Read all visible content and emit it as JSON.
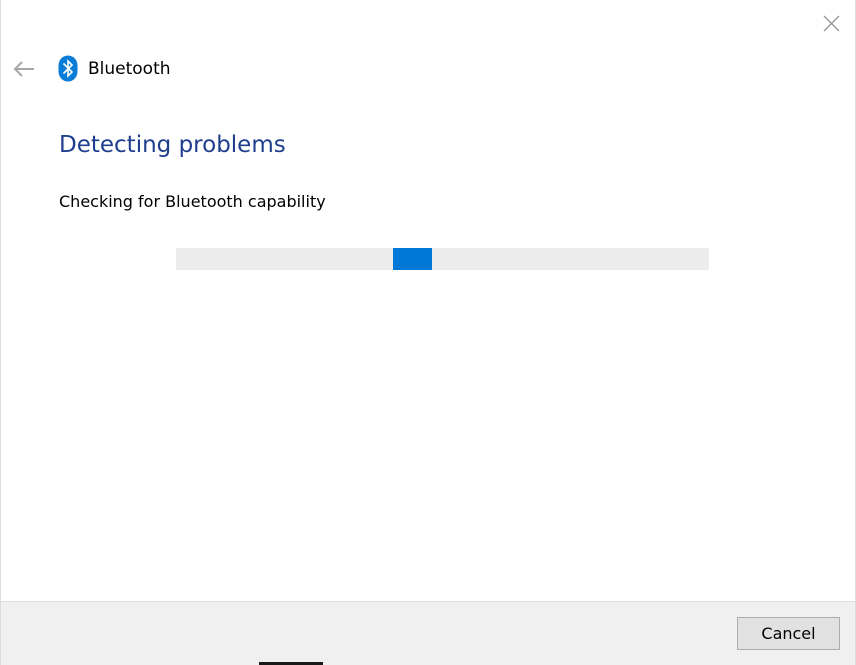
{
  "window": {
    "app_title": "Bluetooth",
    "close_icon": "close-icon",
    "back_icon": "back-arrow-icon",
    "app_icon": "bluetooth-icon"
  },
  "main": {
    "heading": "Detecting problems",
    "status": "Checking for Bluetooth capability",
    "progress": {
      "mode": "indeterminate",
      "chunk_fraction": 0.44
    }
  },
  "footer": {
    "cancel_label": "Cancel"
  },
  "colors": {
    "accent": "#0078d7",
    "heading": "#1e3e8e",
    "track": "#ececec",
    "footer_bg": "#f0f0f0"
  }
}
